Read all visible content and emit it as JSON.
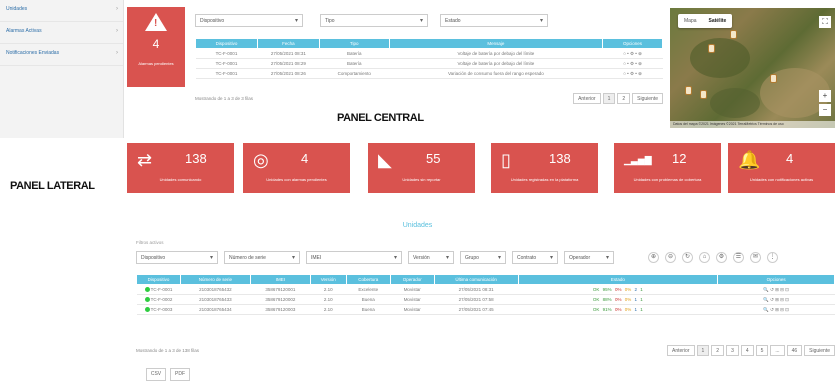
{
  "sidebar": {
    "items": [
      {
        "label": "Unidades"
      },
      {
        "label": "Alarmas Activas"
      },
      {
        "label": "Notificaciones Enviadas"
      }
    ],
    "panel_label": "PANEL LATERAL"
  },
  "alarm_tile": {
    "count": "4",
    "label": "Alarmas pendientes",
    "color": "#d9534f"
  },
  "top_filters": [
    {
      "label": "Dispositivo"
    },
    {
      "label": "Tipo"
    },
    {
      "label": "Estado"
    }
  ],
  "top_table": {
    "headers": [
      "Dispositivo",
      "Fecha",
      "Tipo",
      "Mensaje",
      "Opciones"
    ],
    "rows": [
      [
        "TC-F-0001",
        "27/05/2021 08:31",
        "Batería",
        "Voltaje de batería por debajo del límite",
        "○ • ⚙ • ⊗"
      ],
      [
        "TC-F-0001",
        "27/05/2021 08:29",
        "Batería",
        "Voltaje de batería por debajo del límite",
        "○ • ⚙ • ⊗"
      ],
      [
        "TC-F-0001",
        "27/05/2021 08:26",
        "Comportamiento",
        "Variación de consumo fuera del rango esperado",
        "○ • ⚙ • ⊗"
      ]
    ],
    "footer": "Mostrando de 1 a 3 de 3 filas",
    "pager": [
      "Anterior",
      "1",
      "2",
      "Siguiente"
    ]
  },
  "panel_central_label": "PANEL CENTRAL",
  "map": {
    "tabs": [
      "Mapa",
      "Satélite"
    ],
    "active_tab": "Satélite",
    "fullscreen_icon": "fullscreen-icon",
    "credit": "Datos del mapa ©2021 Imágenes ©2021 TerraMetrics Términos de uso"
  },
  "stats": [
    {
      "icon": "transfer-icon",
      "glyph": "⇄",
      "value": "138",
      "label": "Unidades comunicando"
    },
    {
      "icon": "target-icon",
      "glyph": "◎",
      "value": "4",
      "label": "Unidades con alarmas pendientes"
    },
    {
      "icon": "rss-icon",
      "glyph": "◣",
      "value": "55",
      "label": "Unidades sin reportar"
    },
    {
      "icon": "mobile-icon",
      "glyph": "▯",
      "value": "138",
      "label": "Unidades registradas en la plataforma"
    },
    {
      "icon": "signal-icon",
      "glyph": "▁▃▅▇",
      "value": "12",
      "label": "Unidades con problemas de cobertura"
    },
    {
      "icon": "bell-icon",
      "glyph": "🔔",
      "value": "4",
      "label": "Unidades con notificaciones activas"
    }
  ],
  "units": {
    "title": "Unidades",
    "filtered_label": "Filtros activos",
    "filters": [
      {
        "label": "Dispositivo"
      },
      {
        "label": "Número de serie"
      },
      {
        "label": "IMEI"
      },
      {
        "label": "Versión"
      },
      {
        "label": "Grupo"
      },
      {
        "label": "Contrato"
      },
      {
        "label": "Operador"
      }
    ],
    "tools": [
      "⊕",
      "⊖",
      "↻",
      "⌂",
      "⚙",
      "☰",
      "✉",
      "⋮"
    ],
    "headers": [
      "Dispositivo",
      "Número de serie",
      "IMEI",
      "Versión",
      "Cobertura",
      "Operador",
      "Última comunicación",
      "Estado",
      "Opciones"
    ],
    "rows": [
      {
        "device": "TC-F-0001",
        "serial": "2103018765432",
        "imei": "358679120001",
        "version": "2.10",
        "coverage": "Excelente",
        "operator": "Movistar",
        "last": "27/05/2021 08:31",
        "status": [
          "OK",
          "95%",
          "0%",
          "0%",
          "2",
          "1"
        ]
      },
      {
        "device": "TC-F-0002",
        "serial": "2103018765433",
        "imei": "358679120002",
        "version": "2.10",
        "coverage": "Buena",
        "operator": "Movistar",
        "last": "27/05/2021 07:58",
        "status": [
          "OK",
          "88%",
          "0%",
          "0%",
          "1",
          "1"
        ]
      },
      {
        "device": "TC-F-0003",
        "serial": "2103018765434",
        "imei": "358679120003",
        "version": "2.10",
        "coverage": "Buena",
        "operator": "Movistar",
        "last": "27/05/2021 07:45",
        "status": [
          "OK",
          "91%",
          "0%",
          "0%",
          "1",
          "1"
        ]
      }
    ],
    "options_glyph": "🔍 ↺ ⊞ ⊟ ⊡",
    "footer": "Mostrando de 1 a 3 de 138 filas",
    "pager": [
      "Anterior",
      "1",
      "2",
      "3",
      "4",
      "5",
      "...",
      "46",
      "Siguiente"
    ]
  },
  "export_buttons": [
    "CSV",
    "PDF"
  ]
}
